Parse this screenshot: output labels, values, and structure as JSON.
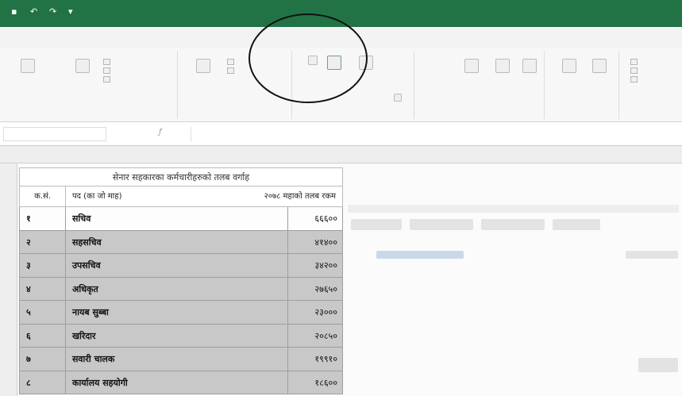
{
  "app": {
    "title_text": "",
    "accent": "#217346"
  },
  "ribbon": {
    "tabs": [
      {
        "label": ""
      },
      {
        "label": ""
      },
      {
        "label": ""
      },
      {
        "label": ""
      },
      {
        "label": ""
      },
      {
        "label": ""
      },
      {
        "label": ""
      },
      {
        "label": ""
      },
      {
        "label": ""
      }
    ],
    "active_tab_index": 5,
    "tell_me": ""
  },
  "sheet": {
    "table": {
      "title": "सेनार सहकारका कर्मचारीहरुको तलब वर्गाह",
      "headers": [
        "क.सं.",
        "पद (का जो माह)",
        "२०७८ महाको तलब रकम"
      ],
      "rows": [
        {
          "no": "१",
          "name": "सचिव",
          "amount": "६६६००"
        },
        {
          "no": "२",
          "name": "सहसचिव",
          "amount": "४१४००"
        },
        {
          "no": "३",
          "name": "उपसचिव",
          "amount": "३४२००"
        },
        {
          "no": "४",
          "name": "अधिकृत",
          "amount": "२७६५०"
        },
        {
          "no": "५",
          "name": "नायब सुब्बा",
          "amount": "२३०००"
        },
        {
          "no": "६",
          "name": "खरिदार",
          "amount": "२०८५०"
        },
        {
          "no": "७",
          "name": "सवारी चालक",
          "amount": "१९९१०"
        },
        {
          "no": "८",
          "name": "कार्यालय सहयोगी",
          "amount": "१८६००"
        }
      ]
    }
  }
}
